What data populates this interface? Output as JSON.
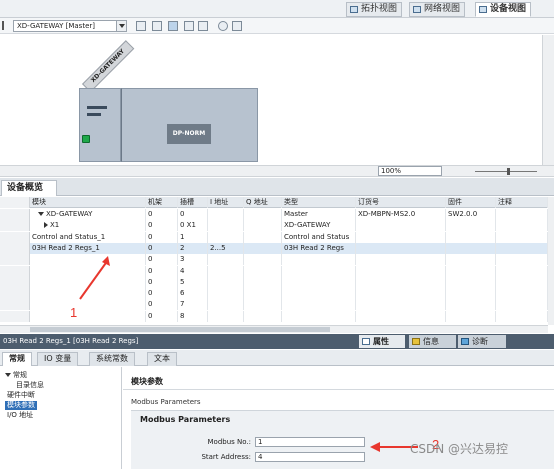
{
  "view_tabs": [
    {
      "label": "拓扑视图",
      "active": false
    },
    {
      "label": "网络视图",
      "active": false
    },
    {
      "label": "设备视图",
      "active": true
    }
  ],
  "toolbar": {
    "device_select": "XD-GATEWAY [Master]",
    "zoom": "100%"
  },
  "canvas": {
    "device_tag": "XD-GATEWAY",
    "module_label": "DP-NORM"
  },
  "overview": {
    "tab_label": "设备概览",
    "columns": [
      "模块",
      "机架",
      "插槽",
      "I 地址",
      "Q 地址",
      "类型",
      "订货号",
      "固件",
      "注释"
    ],
    "rows": [
      {
        "module": "XD-GATEWAY",
        "rack": "0",
        "slot": "0",
        "i_addr": "",
        "q_addr": "",
        "type": "Master",
        "order": "XD-MBPN-MS2.0",
        "fw": "SW2.0.0",
        "comment": "",
        "expand": "down",
        "indent": 1
      },
      {
        "module": "X1",
        "rack": "0",
        "slot": "0 X1",
        "i_addr": "",
        "q_addr": "",
        "type": "XD-GATEWAY",
        "order": "",
        "fw": "",
        "comment": "",
        "expand": "right",
        "indent": 2
      },
      {
        "module": "Control and Status_1",
        "rack": "0",
        "slot": "1",
        "i_addr": "",
        "q_addr": "",
        "type": "Control and Status",
        "order": "",
        "fw": "",
        "comment": "",
        "expand": "",
        "indent": 0
      },
      {
        "module": "03H Read 2 Regs_1",
        "rack": "0",
        "slot": "2",
        "i_addr": "2...5",
        "q_addr": "",
        "type": "03H Read 2 Regs",
        "order": "",
        "fw": "",
        "comment": "",
        "expand": "",
        "indent": 0,
        "selected": true
      },
      {
        "module": "",
        "rack": "0",
        "slot": "3",
        "i_addr": "",
        "q_addr": "",
        "type": "",
        "order": "",
        "fw": "",
        "comment": "",
        "expand": "",
        "indent": 0
      },
      {
        "module": "",
        "rack": "0",
        "slot": "4",
        "i_addr": "",
        "q_addr": "",
        "type": "",
        "order": "",
        "fw": "",
        "comment": "",
        "expand": "",
        "indent": 0
      },
      {
        "module": "",
        "rack": "0",
        "slot": "5",
        "i_addr": "",
        "q_addr": "",
        "type": "",
        "order": "",
        "fw": "",
        "comment": "",
        "expand": "",
        "indent": 0
      },
      {
        "module": "",
        "rack": "0",
        "slot": "6",
        "i_addr": "",
        "q_addr": "",
        "type": "",
        "order": "",
        "fw": "",
        "comment": "",
        "expand": "",
        "indent": 0
      },
      {
        "module": "",
        "rack": "0",
        "slot": "7",
        "i_addr": "",
        "q_addr": "",
        "type": "",
        "order": "",
        "fw": "",
        "comment": "",
        "expand": "",
        "indent": 0
      },
      {
        "module": "",
        "rack": "0",
        "slot": "8",
        "i_addr": "",
        "q_addr": "",
        "type": "",
        "order": "",
        "fw": "",
        "comment": "",
        "expand": "",
        "indent": 0
      }
    ]
  },
  "selection_bar": {
    "title": "03H Read 2 Regs_1 [03H Read 2 Regs]",
    "properties_label": "属性",
    "info_label": "信息",
    "diag_label": "诊断"
  },
  "property_tabs": [
    {
      "label": "常规",
      "active": true
    },
    {
      "label": "IO 变量",
      "active": false
    },
    {
      "label": "系统常数",
      "active": false
    },
    {
      "label": "文本",
      "active": false
    }
  ],
  "nav_tree": [
    {
      "label": "常规",
      "level": 0,
      "selected": false
    },
    {
      "label": "目录信息",
      "level": 1,
      "selected": false
    },
    {
      "label": "硬件中断",
      "level": 0,
      "selected": false
    },
    {
      "label": "模块参数",
      "level": 0,
      "selected": true
    },
    {
      "label": "I/O 地址",
      "level": 0,
      "selected": false
    }
  ],
  "properties": {
    "section_title": "模块参数",
    "parent_label": "Modbus Parameters",
    "box_title": "Modbus Parameters",
    "fields": [
      {
        "label": "Modbus No.:",
        "value": "1"
      },
      {
        "label": "Start Address:",
        "value": "4"
      }
    ]
  },
  "annotations": {
    "arrow_color": "#e8372e",
    "label_1": "1",
    "label_2": "2"
  },
  "watermark": "CSDN @兴达易控"
}
